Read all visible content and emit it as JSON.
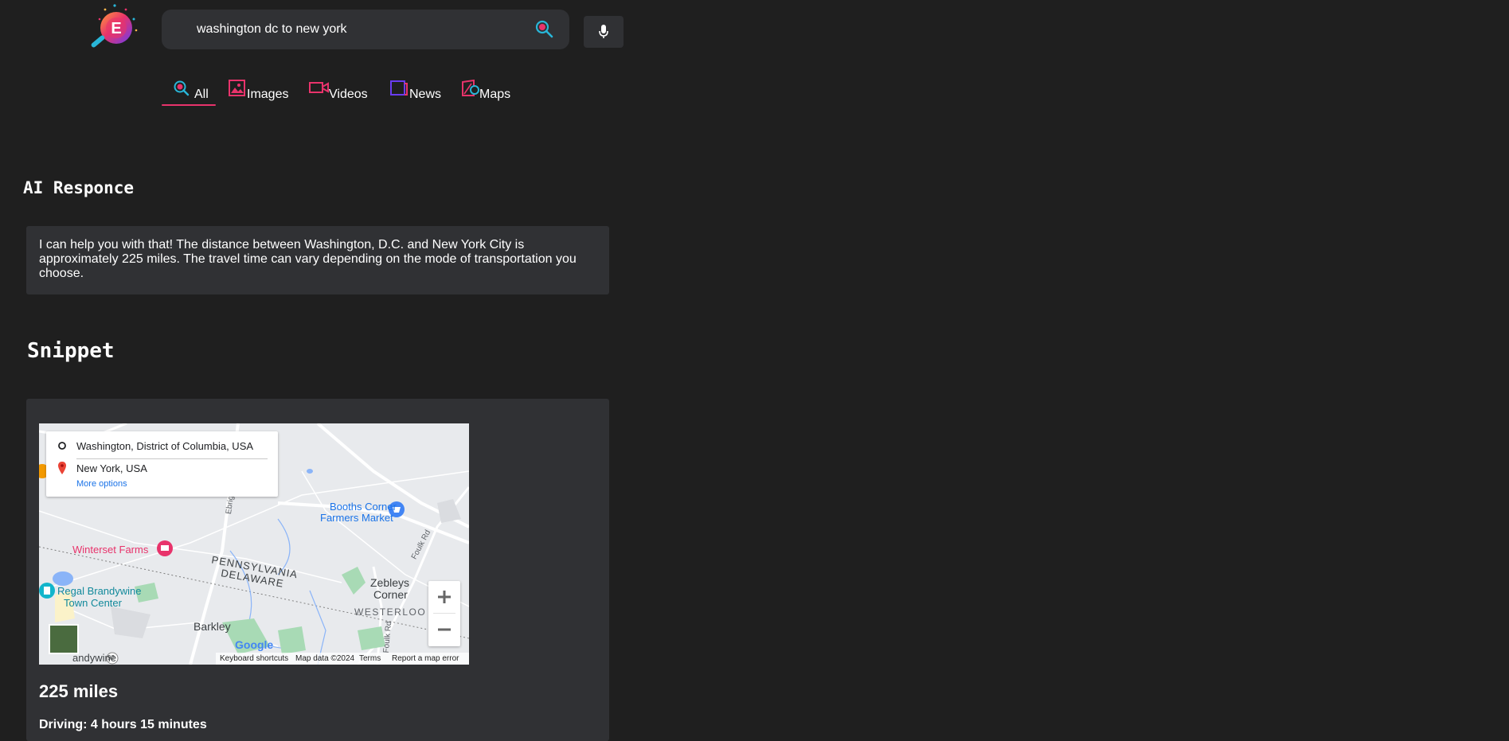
{
  "colors": {
    "background": "#1f1f1f",
    "card": "#303134",
    "accent_pink": "#e8336b",
    "accent_cyan": "#29b6d8",
    "map_link": "#1a73e8"
  },
  "logo": {
    "letter": "E",
    "icon": "logo-magnifier-icon"
  },
  "search": {
    "value": "washington dc to new york",
    "search_icon": "search-icon",
    "mic_icon": "microphone-icon"
  },
  "tabs": [
    {
      "label": "All",
      "icon": "search-icon",
      "active": true
    },
    {
      "label": "Images",
      "icon": "image-icon",
      "active": false
    },
    {
      "label": "Videos",
      "icon": "video-icon",
      "active": false
    },
    {
      "label": "News",
      "icon": "news-icon",
      "active": false
    },
    {
      "label": "Maps",
      "icon": "map-icon",
      "active": false
    }
  ],
  "ai": {
    "title": "AI Responce",
    "text": "I can help you with that! The distance between Washington, D.C. and New York City is approximately 225 miles. The travel time can vary depending on the mode of transportation you choose."
  },
  "snippet": {
    "title": "Snippet",
    "map": {
      "origin": "Washington, District of Columbia, USA",
      "destination": "New York, USA",
      "more_options": "More options",
      "places": {
        "booths_corner_1": "Booths Corner",
        "booths_corner_2": "Farmers Market",
        "winterset": "Winterset Farms",
        "pennsylvania": "PENNSYLVANIA",
        "delaware": "DELAWARE",
        "zebleys_1": "Zebleys",
        "zebleys_2": "Corner",
        "westerloo": "WESTERLOO",
        "regal_1": "Regal Brandywine",
        "regal_2": "Town Center",
        "barkley": "Barkley",
        "ebright_rd": "Ebright Rd",
        "foulk_rd": "Foulk Rd",
        "foulk_rd_2": "Foulk Rd",
        "brandywine_partial": "andywine",
        "route": "92",
        "google": "Google"
      },
      "footer": {
        "shortcuts": "Keyboard shortcuts",
        "data": "Map data ©2024",
        "terms": "Terms",
        "report": "Report a map error"
      }
    },
    "distance": "225 miles",
    "driving": "Driving: 4 hours 15 minutes"
  }
}
